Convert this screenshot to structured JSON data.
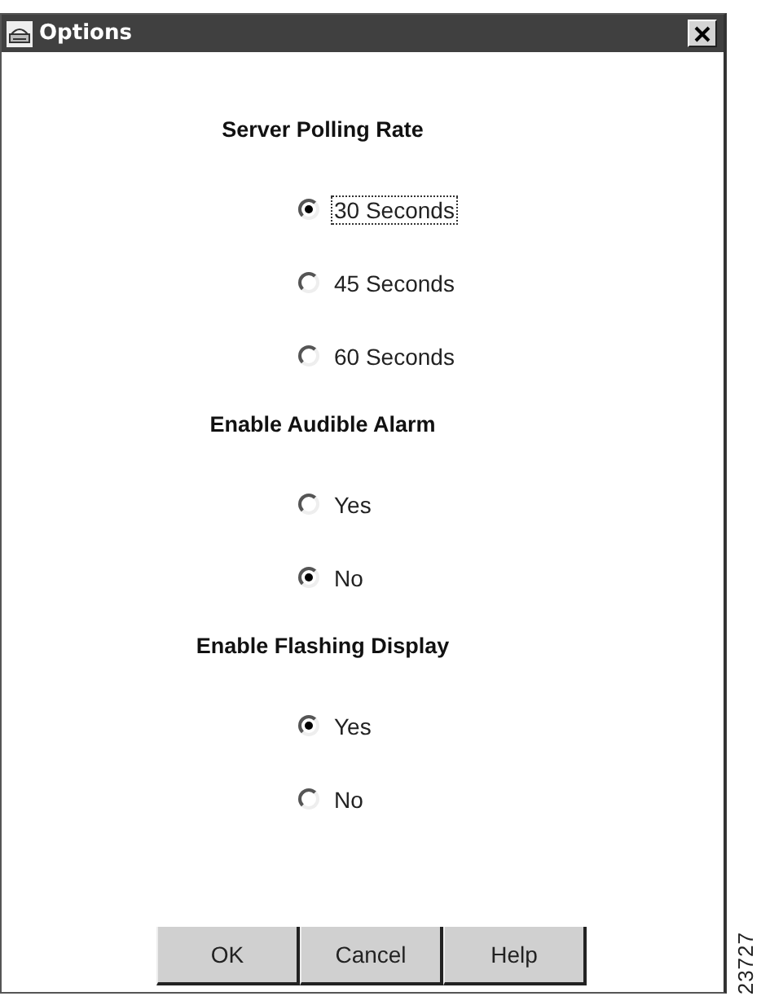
{
  "window": {
    "title": "Options"
  },
  "groups": [
    {
      "title": "Server Polling Rate",
      "options": [
        {
          "label": "30 Seconds",
          "selected": true,
          "focused": true
        },
        {
          "label": "45 Seconds",
          "selected": false,
          "focused": false
        },
        {
          "label": "60 Seconds",
          "selected": false,
          "focused": false
        }
      ]
    },
    {
      "title": "Enable Audible Alarm",
      "options": [
        {
          "label": "Yes",
          "selected": false,
          "focused": false
        },
        {
          "label": "No",
          "selected": true,
          "focused": false
        }
      ]
    },
    {
      "title": "Enable Flashing Display",
      "options": [
        {
          "label": "Yes",
          "selected": true,
          "focused": false
        },
        {
          "label": "No",
          "selected": false,
          "focused": false
        }
      ]
    }
  ],
  "buttons": [
    "OK",
    "Cancel",
    "Help"
  ],
  "figure_id": "23727"
}
